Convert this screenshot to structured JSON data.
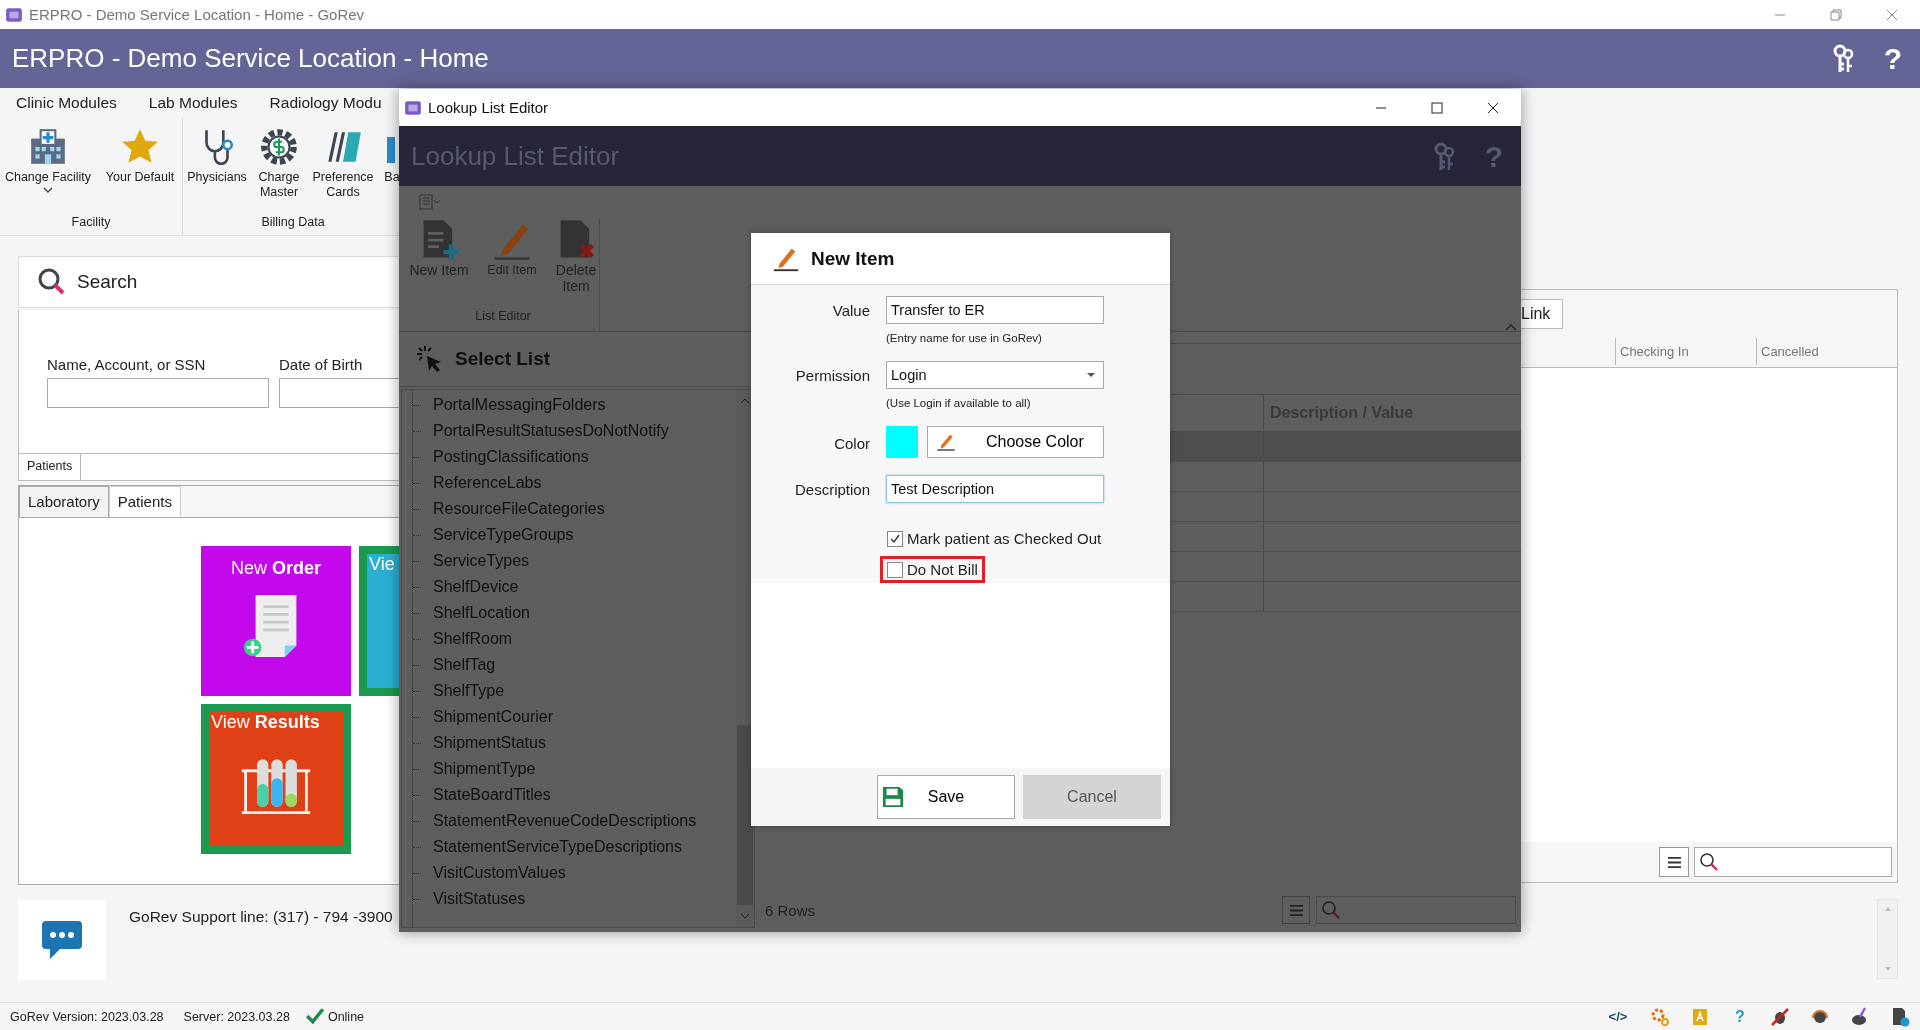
{
  "os_window": {
    "title": "ERPRO - Demo Service Location - Home - GoRev"
  },
  "header": {
    "title": "ERPRO - Demo Service Location - Home",
    "help": "?"
  },
  "ribbon": {
    "tabs": [
      {
        "label": "Clinic Modules",
        "selected": false
      },
      {
        "label": "Lab Modules",
        "selected": false
      },
      {
        "label": "Radiology Modu",
        "selected": false
      }
    ],
    "groups": [
      {
        "label": "Facility",
        "items": [
          {
            "label": "Change Facility",
            "kind": "hospital",
            "dropdown": true
          },
          {
            "label": "Your Default",
            "kind": "star",
            "dropdown": false
          }
        ]
      },
      {
        "label": "Billing Data",
        "items": [
          {
            "label": "Physicians",
            "kind": "stethoscope",
            "dropdown": false
          },
          {
            "label": "Charge Master",
            "kind": "gear",
            "dropdown": false
          },
          {
            "label": "Preference Cards",
            "kind": "cards",
            "dropdown": false
          },
          {
            "label": "Ba",
            "kind": "partial",
            "dropdown": false
          }
        ]
      }
    ]
  },
  "search_panel": {
    "title": "Search",
    "fields": [
      {
        "label": "Name, Account, or SSN"
      },
      {
        "label": "Date of Birth"
      }
    ],
    "tabs": [
      {
        "label": "Patients",
        "selected": true
      }
    ]
  },
  "module_tabs": [
    {
      "label": "Laboratory",
      "selected": true
    },
    {
      "label": "Patients",
      "selected": false
    }
  ],
  "tiles": [
    {
      "kind": "new_order",
      "title": "New **Order**",
      "color": "#c408ec"
    },
    {
      "kind": "partial",
      "title": "Vie",
      "color": "#2ab0d4"
    },
    {
      "kind": "view_results",
      "title": "View **Results**",
      "color": "#e04016"
    }
  ],
  "support": {
    "text": "GoRev Support line: (317) - 794 -3900"
  },
  "right_panel": {
    "link_button": "Link",
    "columns": [
      "Checking In",
      "Cancelled"
    ]
  },
  "status_bar": {
    "version": "GoRev Version:  2023.03.28",
    "server": "Server:  2023.03.28",
    "status": "Online",
    "code": "</>",
    "help": "?"
  },
  "lookup_window": {
    "title": "Lookup List Editor",
    "header": "Lookup List Editor",
    "help": "?",
    "toolbar": [
      {
        "label": "New Item",
        "kind": "new"
      },
      {
        "label": "Edit Item",
        "kind": "edit"
      },
      {
        "label": "Delete Item",
        "kind": "delete"
      }
    ],
    "toolbar_group": "List Editor",
    "select_list": {
      "title": "Select List",
      "items": [
        "PortalMessagingFolders",
        "PortalResultStatusesDoNotNotify",
        "PostingClassifications",
        "ReferenceLabs",
        "ResourceFileCategories",
        "ServiceTypeGroups",
        "ServiceTypes",
        "ShelfDevice",
        "ShelfLocation",
        "ShelfRoom",
        "ShelfTag",
        "ShelfType",
        "ShipmentCourier",
        "ShipmentStatus",
        "ShipmentType",
        "StateBoardTitles",
        "StatementRevenueCodeDescriptions",
        "StatementServiceTypeDescriptions",
        "VisitCustomValues",
        "VisitStatuses"
      ]
    },
    "grid": {
      "columns": [
        "Description / Value"
      ],
      "rows": [
        {
          "selected": true
        },
        {
          "selected": false
        },
        {
          "selected": false
        },
        {
          "selected": false
        },
        {
          "selected": false
        },
        {
          "selected": false
        }
      ]
    },
    "row_count": "6 Rows"
  },
  "dialog": {
    "title": "New Item",
    "value": {
      "label": "Value",
      "value": "Transfer to ER",
      "hint": "(Entry name for use in GoRev)"
    },
    "permission": {
      "label": "Permission",
      "value": "Login",
      "hint": "(Use Login if available to all)"
    },
    "color": {
      "label": "Color",
      "color": "#00ffff",
      "button": "Choose Color"
    },
    "description": {
      "label": "Description",
      "value": "Test Description"
    },
    "checkboxes": [
      {
        "label": "Mark patient as Checked Out",
        "checked": true,
        "highlighted": false
      },
      {
        "label": "Do Not Bill",
        "checked": false,
        "highlighted": true
      }
    ],
    "buttons": [
      {
        "label": "Save",
        "kind": "save"
      },
      {
        "label": "Cancel",
        "kind": "cancel"
      }
    ]
  }
}
